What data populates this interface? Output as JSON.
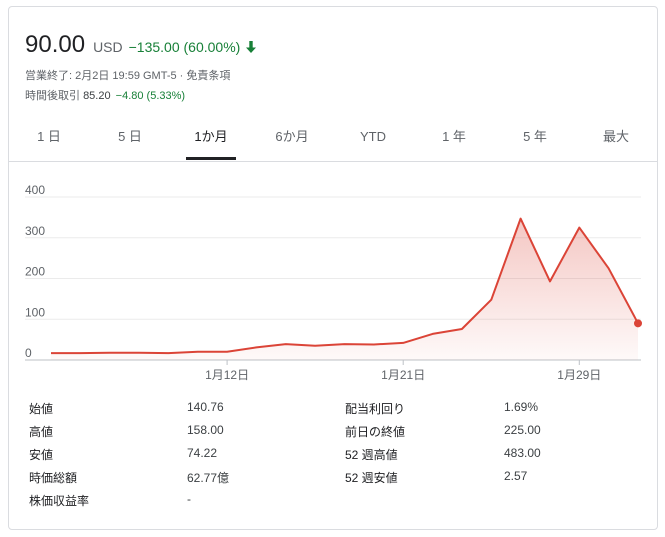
{
  "header": {
    "price": "90.00",
    "currency": "USD",
    "change": "−135.00 (60.00%)",
    "market_status": "営業終了: 2月2日 19:59 GMT-5 · 免責条項",
    "after_hours_label": "時間後取引",
    "after_hours_value": "85.20",
    "after_hours_change": "−4.80 (5.33%)"
  },
  "tabs": [
    {
      "label": "1 日"
    },
    {
      "label": "5 日"
    },
    {
      "label": "1か月",
      "active": true
    },
    {
      "label": "6か月"
    },
    {
      "label": "YTD"
    },
    {
      "label": "1 年"
    },
    {
      "label": "5 年"
    },
    {
      "label": "最大"
    }
  ],
  "chart_data": {
    "type": "area",
    "ylim": [
      0,
      400
    ],
    "y_ticks": [
      "0",
      "100",
      "200",
      "300",
      "400"
    ],
    "x_tick_labels": [
      "1月12日",
      "1月21日",
      "1月29日"
    ],
    "series": [
      {
        "values": [
          17,
          17,
          18,
          18,
          17,
          20,
          20,
          31,
          39,
          35,
          39,
          38,
          42,
          64,
          76,
          148,
          347,
          193,
          325,
          225,
          90
        ]
      }
    ],
    "line_color": "#db4437",
    "fill_color": "#f4c7c3"
  },
  "stats": [
    {
      "label": "始値",
      "value": "140.76",
      "label2": "配当利回り",
      "value2": "1.69%"
    },
    {
      "label": "高値",
      "value": "158.00",
      "label2": "前日の終値",
      "value2": "225.00"
    },
    {
      "label": "安値",
      "value": "74.22",
      "label2": "52 週高値",
      "value2": "483.00"
    },
    {
      "label": "時価総額",
      "value": "62.77億",
      "label2": "52 週安値",
      "value2": "2.57"
    },
    {
      "label": "株価収益率",
      "value": "-",
      "label2": "",
      "value2": ""
    }
  ]
}
